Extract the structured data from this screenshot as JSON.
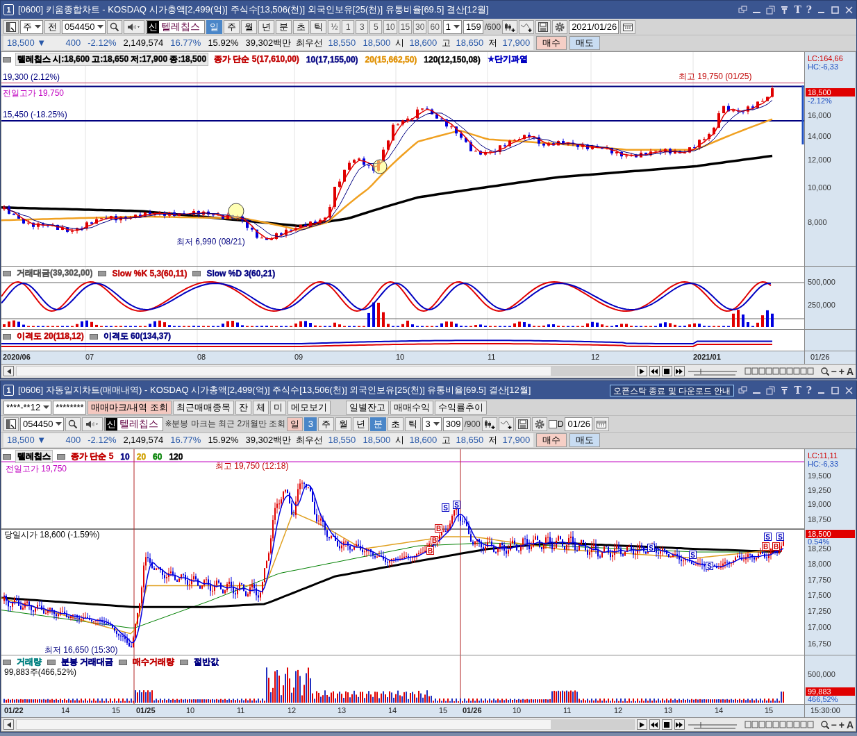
{
  "windows": [
    {
      "badge": "1",
      "title": "[0600] 키움종합차트 - KOSDAQ 시가총액[2,499(억)] 주식수[13,506(천)] 외국인보유[25(천)] 유통비율[69.5] 결산[12월]",
      "text_glyph": "T",
      "help_glyph": "?",
      "toolbars": [
        [
          {
            "kind": "layout"
          },
          {
            "kind": "combo",
            "value": "주"
          },
          {
            "kind": "btn",
            "label": "전",
            "selected": false
          },
          {
            "kind": "combo",
            "value": "054450"
          },
          {
            "kind": "search"
          },
          {
            "kind": "speaker"
          },
          {
            "kind": "stock",
            "badge": "신",
            "name": "텔레칩스"
          },
          {
            "kind": "btn",
            "label": "일",
            "selected": true
          },
          {
            "kind": "btn",
            "label": "주",
            "selected": false
          },
          {
            "kind": "btn",
            "label": "월",
            "selected": false
          },
          {
            "kind": "btn",
            "label": "년",
            "selected": false
          },
          {
            "kind": "btn",
            "label": "분",
            "selected": false
          },
          {
            "kind": "btn",
            "label": "초",
            "selected": false
          },
          {
            "kind": "btn",
            "label": "틱",
            "selected": false
          },
          {
            "kind": "btn",
            "label": "½",
            "selected": false
          },
          {
            "kind": "btn",
            "label": "1",
            "selected": false
          },
          {
            "kind": "btn",
            "label": "3",
            "selected": false
          },
          {
            "kind": "btn",
            "label": "5",
            "selected": false
          },
          {
            "kind": "btn",
            "label": "10",
            "selected": false
          },
          {
            "kind": "btn",
            "label": "15",
            "selected": false
          },
          {
            "kind": "btn",
            "label": "30",
            "selected": false
          },
          {
            "kind": "btn",
            "label": "60",
            "selected": false
          },
          {
            "kind": "combo",
            "value": "1"
          },
          {
            "kind": "field",
            "value": "159"
          },
          {
            "kind": "text",
            "text": "/600"
          },
          {
            "kind": "candle"
          },
          {
            "kind": "line"
          },
          {
            "kind": "save"
          },
          {
            "kind": "gear"
          },
          {
            "kind": "field",
            "value": "2021/01/26"
          },
          {
            "kind": "calendar"
          }
        ]
      ],
      "quote": [
        {
          "kind": "value",
          "text": "18,500 ▼"
        },
        {
          "kind": "value",
          "text": "400"
        },
        {
          "kind": "value",
          "text": "-2.12%"
        },
        {
          "kind": "plain",
          "text": "2,149,574"
        },
        {
          "kind": "value",
          "text": "16.77%"
        },
        {
          "kind": "plain",
          "text": "15.92%"
        },
        {
          "kind": "plain",
          "text": "39,302백만"
        },
        {
          "kind": "label",
          "text": "최우선"
        },
        {
          "kind": "value",
          "text": "18,550"
        },
        {
          "kind": "value",
          "text": "18,500"
        },
        {
          "kind": "label",
          "text": "시"
        },
        {
          "kind": "value",
          "text": "18,600"
        },
        {
          "kind": "label",
          "text": "고"
        },
        {
          "kind": "value",
          "text": "18,650"
        },
        {
          "kind": "label",
          "text": "저"
        },
        {
          "kind": "value",
          "text": "17,900"
        },
        {
          "kind": "buy",
          "text": "매수"
        },
        {
          "kind": "sell",
          "text": "매도"
        }
      ],
      "chart": {
        "kind": "daily",
        "legend": [
          {
            "text": "텔레칩스 시:18,600 고:18,650 저:17,900 종:18,500",
            "color": "#000000"
          },
          {
            "text": "종가 단순 5(17,610,00)",
            "color": "#c00000"
          },
          {
            "text": "10(17,155,00)",
            "color": "#000080"
          },
          {
            "text": "20(15,662,50)",
            "color": "#e09000"
          },
          {
            "text": "120(12,150,08)",
            "color": "#000000"
          },
          {
            "text": "★단기과열",
            "color": "#0000c0"
          }
        ],
        "annotations": [
          {
            "text": "19,300 (2.12%)",
            "color": "#000080"
          },
          {
            "text": "전일고가 19,750",
            "color": "#c000c0"
          },
          {
            "text": "15,450 (-18.25%)",
            "color": "#000080"
          },
          {
            "text": "최고 19,750 (01/25)",
            "color": "#c00000"
          },
          {
            "text": "최저 6,990 (08/21)",
            "color": "#000080"
          }
        ],
        "axis": [
          {
            "kind": "lc",
            "text": "LC:164,66"
          },
          {
            "kind": "hc",
            "text": "HC:-6,33"
          },
          {
            "kind": "price",
            "text": "18,500"
          },
          {
            "kind": "pct",
            "text": "-2.12%"
          },
          {
            "kind": "tick",
            "text": "16,000"
          },
          {
            "kind": "tick",
            "text": "14,000"
          },
          {
            "kind": "tick",
            "text": "12,000"
          },
          {
            "kind": "tick",
            "text": "10,000"
          },
          {
            "kind": "tick",
            "text": "8,000"
          }
        ],
        "panes": [
          {
            "legend": [
              {
                "text": "거래대금(39,302,00)",
                "color": "#555555"
              },
              {
                "text": "Slow %K 5,3(60,11)",
                "color": "#c00000"
              },
              {
                "text": "Slow %D 3(60,21)",
                "color": "#000080"
              }
            ],
            "axis": [
              {
                "kind": "tick",
                "text": "500,000"
              },
              {
                "kind": "tick",
                "text": "250,000"
              }
            ]
          },
          {
            "legend": [
              {
                "text": "이격도 20(118,12)",
                "color": "#c00000"
              },
              {
                "text": "이격도 60(134,37)",
                "color": "#000080"
              }
            ]
          }
        ],
        "xaxis": [
          "2020/06",
          "07",
          "08",
          "09",
          "10",
          "11",
          "12",
          "2021/01"
        ],
        "xaxis_end": "01/26",
        "tool_glyphs": [
          "−",
          "+",
          "A"
        ]
      }
    },
    {
      "badge": "1",
      "title": "[0606] 자동일지차트(매매내역) - KOSDAQ 시가총액[2,499(억)] 주식수[13,506(천)] 외국인보유[25(천)] 유통비율[69.5] 결산[12월]",
      "notice": "오픈스탁 종료 및 다운로드 안내",
      "text_glyph": "T",
      "help_glyph": "?",
      "toolbars": [
        [
          {
            "kind": "combo",
            "value": "****-**12"
          },
          {
            "kind": "field",
            "value": "********"
          },
          {
            "kind": "mark",
            "label": "매매마크/내역 조회",
            "selected": false
          },
          {
            "kind": "btn",
            "label": "최근매매종목",
            "selected": false
          },
          {
            "kind": "btn",
            "label": "잔",
            "selected": false
          },
          {
            "kind": "btn",
            "label": "체",
            "selected": false
          },
          {
            "kind": "btn",
            "label": "미",
            "selected": false
          },
          {
            "kind": "btn",
            "label": "메모보기",
            "selected": false
          },
          {
            "kind": "gap"
          },
          {
            "kind": "btn",
            "label": "일별잔고",
            "selected": false
          },
          {
            "kind": "btn",
            "label": "매매수익",
            "selected": false
          },
          {
            "kind": "btn",
            "label": "수익률추이",
            "selected": false
          }
        ],
        [
          {
            "kind": "layout"
          },
          {
            "kind": "combo",
            "value": "054450"
          },
          {
            "kind": "search"
          },
          {
            "kind": "speaker"
          },
          {
            "kind": "stock",
            "badge": "신",
            "name": "텔레칩스"
          },
          {
            "kind": "text",
            "text": "※분봉 마크는 최근 2개월만 조회"
          },
          {
            "kind": "mark",
            "label": "일",
            "selected": false
          },
          {
            "kind": "btn",
            "label": "3",
            "selected": true
          },
          {
            "kind": "btn",
            "label": "주",
            "selected": false
          },
          {
            "kind": "btn",
            "label": "월",
            "selected": false
          },
          {
            "kind": "btn",
            "label": "년",
            "selected": false
          },
          {
            "kind": "btn",
            "label": "분",
            "selected": true
          },
          {
            "kind": "btn",
            "label": "초",
            "selected": false
          },
          {
            "kind": "btn",
            "label": "틱",
            "selected": false
          },
          {
            "kind": "combo",
            "value": "3"
          },
          {
            "kind": "field",
            "value": "309"
          },
          {
            "kind": "text",
            "text": "/900"
          },
          {
            "kind": "candle"
          },
          {
            "kind": "line"
          },
          {
            "kind": "save"
          },
          {
            "kind": "gear"
          },
          {
            "kind": "checkbox",
            "label": "D",
            "checked": false
          },
          {
            "kind": "field",
            "value": "01/26"
          },
          {
            "kind": "calendar"
          }
        ]
      ],
      "quote": [
        {
          "kind": "value",
          "text": "18,500 ▼"
        },
        {
          "kind": "value",
          "text": "400"
        },
        {
          "kind": "value",
          "text": "-2.12%"
        },
        {
          "kind": "plain",
          "text": "2,149,574"
        },
        {
          "kind": "value",
          "text": "16.77%"
        },
        {
          "kind": "plain",
          "text": "15.92%"
        },
        {
          "kind": "plain",
          "text": "39,302백만"
        },
        {
          "kind": "label",
          "text": "최우선"
        },
        {
          "kind": "value",
          "text": "18,550"
        },
        {
          "kind": "value",
          "text": "18,500"
        },
        {
          "kind": "label",
          "text": "시"
        },
        {
          "kind": "value",
          "text": "18,600"
        },
        {
          "kind": "label",
          "text": "고"
        },
        {
          "kind": "value",
          "text": "18,650"
        },
        {
          "kind": "label",
          "text": "저"
        },
        {
          "kind": "value",
          "text": "17,900"
        },
        {
          "kind": "buy",
          "text": "매수"
        },
        {
          "kind": "sell",
          "text": "매도"
        }
      ],
      "chart": {
        "kind": "minute",
        "legend": [
          {
            "text": "텔레칩스",
            "color": "#000000"
          },
          {
            "text": "종가 단순 5",
            "color": "#c00000"
          },
          {
            "text": "10",
            "color": "#000080"
          },
          {
            "text": "20",
            "color": "#d0a000"
          },
          {
            "text": "60",
            "color": "#008000"
          },
          {
            "text": "120",
            "color": "#000000"
          }
        ],
        "annotations": [
          {
            "text": "전일고가 19,750",
            "color": "#c000c0"
          },
          {
            "text": "최고 19,750 (12:18)",
            "color": "#c00000"
          },
          {
            "text": "당일시가 18,600 (-1.59%)",
            "color": "#000000"
          },
          {
            "text": "최저 16,650 (15:30)",
            "color": "#000080"
          }
        ],
        "axis": [
          {
            "kind": "lc",
            "text": "LC:11,11"
          },
          {
            "kind": "hc",
            "text": "HC:-6,33"
          },
          {
            "kind": "tick",
            "text": "19,500"
          },
          {
            "kind": "tick",
            "text": "19,250"
          },
          {
            "kind": "tick",
            "text": "19,000"
          },
          {
            "kind": "tick",
            "text": "18,750"
          },
          {
            "kind": "price",
            "text": "18,500"
          },
          {
            "kind": "pct",
            "text": "0.54%"
          },
          {
            "kind": "tick",
            "text": "18,250"
          },
          {
            "kind": "tick",
            "text": "18,000"
          },
          {
            "kind": "tick",
            "text": "17,750"
          },
          {
            "kind": "tick",
            "text": "17,500"
          },
          {
            "kind": "tick",
            "text": "17,250"
          },
          {
            "kind": "tick",
            "text": "17,000"
          },
          {
            "kind": "tick",
            "text": "16,750"
          }
        ],
        "marks": [
          {
            "kind": "buy",
            "label": "B"
          },
          {
            "kind": "buy",
            "label": "B"
          },
          {
            "kind": "buy",
            "label": "B"
          },
          {
            "kind": "sell",
            "label": "S"
          },
          {
            "kind": "sell",
            "label": "S"
          },
          {
            "kind": "sell",
            "label": "S"
          },
          {
            "kind": "sell",
            "label": "S"
          },
          {
            "kind": "sell",
            "label": "S"
          },
          {
            "kind": "buy",
            "label": "B"
          },
          {
            "kind": "sell",
            "label": "S"
          },
          {
            "kind": "buy",
            "label": "B"
          },
          {
            "kind": "sell",
            "label": "S"
          }
        ],
        "panes": [
          {
            "legend": [
              {
                "text": "거래량",
                "color": "#008080"
              },
              {
                "text": "분봉 거래대금",
                "color": "#000080"
              },
              {
                "text": "매수거래량",
                "color": "#c00000"
              },
              {
                "text": "절반값",
                "color": "#000080"
              }
            ],
            "annotations": [
              {
                "text": "99,883주(466,52%)",
                "color": "#000000"
              }
            ],
            "axis": [
              {
                "kind": "tick",
                "text": "500,000"
              },
              {
                "kind": "price",
                "text": "99,883"
              },
              {
                "kind": "pct",
                "text": "466,52%"
              }
            ]
          }
        ],
        "xaxis": [
          "01/22",
          "14",
          "15",
          "01/25",
          "10",
          "11",
          "12",
          "13",
          "14",
          "15",
          "01/26",
          "10",
          "11",
          "12",
          "13",
          "14",
          "15"
        ],
        "xaxis_end": "15:30:00",
        "tool_glyphs": [
          "−",
          "+",
          "A"
        ]
      }
    }
  ]
}
